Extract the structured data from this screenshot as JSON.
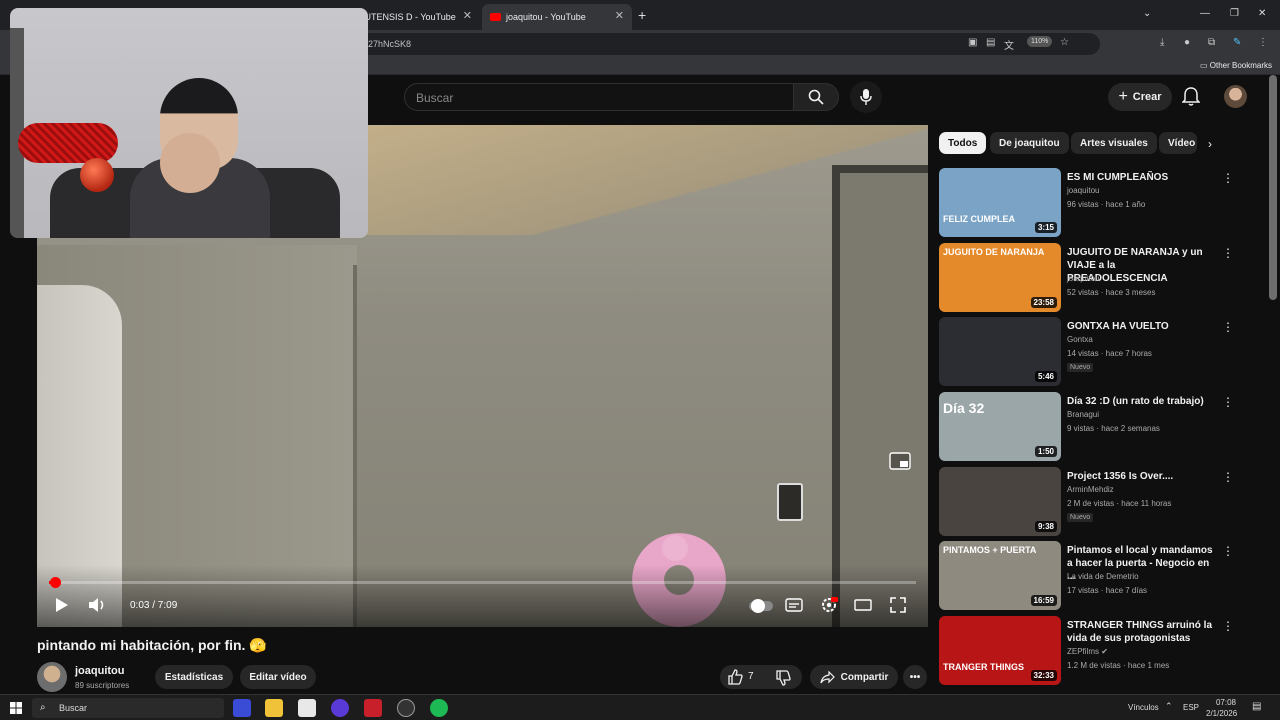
{
  "browser": {
    "tabs": [
      {
        "label": "CUTENSIS D - YouTube"
      },
      {
        "label": "joaquitou - YouTube",
        "active": true
      }
    ],
    "url_fragment": "27hNcSK8",
    "zoom": "110%",
    "bookmarks": {
      "other": "Other Bookmarks"
    }
  },
  "header": {
    "search_placeholder": "Buscar",
    "create_label": "Crear"
  },
  "player": {
    "time": "0:03 / 7:09",
    "progress_fraction": 0.007
  },
  "video": {
    "title": "pintando mi habitación, por fin. 🫣",
    "channel": "joaquitou",
    "subscribers": "89 suscriptores",
    "buttons": {
      "stats": "Estadísticas",
      "edit": "Editar vídeo",
      "like_count": "7",
      "share": "Compartir"
    }
  },
  "sidebar": {
    "chips": [
      {
        "label": "Todos",
        "active": true
      },
      {
        "label": "De joaquitou"
      },
      {
        "label": "Artes visuales"
      },
      {
        "label": "Vídeo"
      }
    ],
    "recommendations": [
      {
        "title": "ES MI CUMPLEAÑOS",
        "channel": "joaquitou",
        "meta": "96 vistas · hace 1 año",
        "duration": "3:15",
        "thumb_color": "#7aa3c6",
        "thumb_text": "FELIZ CUMPLEA"
      },
      {
        "title": "JUGUITO DE NARANJA y un VIAJE a la PREADOLESCENCIA",
        "channel": "joaquitou",
        "meta": "52 vistas · hace 3 meses",
        "duration": "23:58",
        "thumb_color": "#e58a2a",
        "thumb_text": "JUGUITO DE NARANJA"
      },
      {
        "title": "GONTXA HA VUELTO",
        "channel": "Gontxa",
        "meta": "14 vistas · hace 7 horas",
        "badge": "Nuevo",
        "duration": "5:46",
        "thumb_color": "#2c2c33",
        "thumb_text": ""
      },
      {
        "title": "Día 32 :D (un rato de trabajo)",
        "channel": "Branagui",
        "meta": "9 vistas · hace 2 semanas",
        "duration": "1:50",
        "thumb_color": "#9ba6a8",
        "thumb_text": "Día 32"
      },
      {
        "title": "Project 1356 Is Over....",
        "channel": "ArminMehdiz",
        "meta": "2 M de vistas · hace 11 horas",
        "badge": "Nuevo",
        "duration": "9:38",
        "thumb_color": "#4a4440",
        "thumb_text": ""
      },
      {
        "title": "Pintamos el local y mandamos a hacer la puerta - Negocio en ...",
        "channel": "La vida de Demetrio",
        "meta": "17 vistas · hace 7 días",
        "duration": "16:59",
        "thumb_color": "#8e8a80",
        "thumb_text": "PINTAMOS + PUERTA"
      },
      {
        "title": "STRANGER THINGS arruinó la vida de sus protagonistas",
        "channel": "ZEPfilms ✔",
        "meta": "1.2 M de vistas · hace 1 mes",
        "duration": "32:33",
        "thumb_color": "#b81616",
        "thumb_text": "TRANGER THINGS"
      }
    ]
  },
  "taskbar": {
    "search_label": "Buscar",
    "tray_links": "Vínculos",
    "lang": "ESP",
    "time": "07:08",
    "date": "2/1/2026"
  },
  "colors": {
    "youtube_red": "#ff0000",
    "background": "#0f0f0f",
    "chip": "#272727"
  }
}
